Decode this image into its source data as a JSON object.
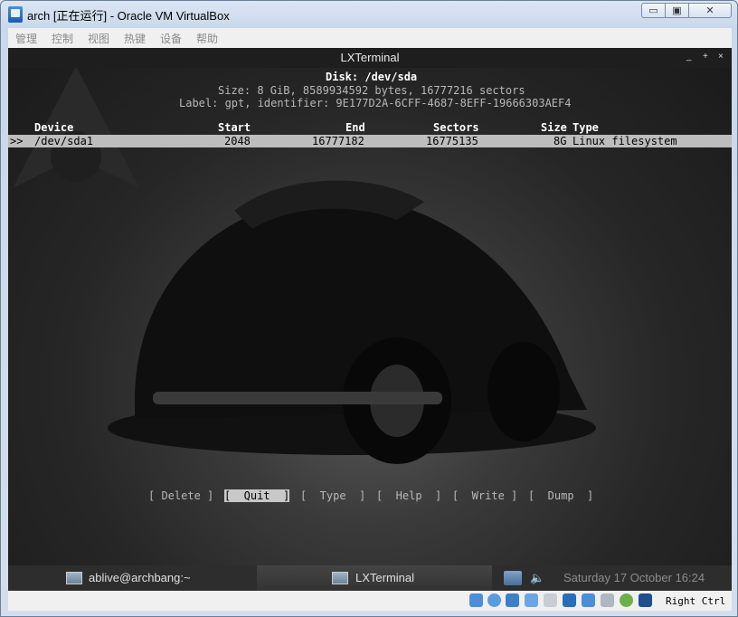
{
  "window": {
    "title": "arch [正在运行] - Oracle VM VirtualBox",
    "controls": {
      "minimize": "▭",
      "maximize": "▣",
      "close": "✕"
    }
  },
  "menu": [
    "管理",
    "控制",
    "视图",
    "热键",
    "设备",
    "帮助"
  ],
  "terminal": {
    "title": "LXTerminal",
    "controls": [
      "_",
      "+",
      "×"
    ]
  },
  "cfdisk": {
    "disk_line": "Disk: /dev/sda",
    "size_line": "Size: 8 GiB, 8589934592 bytes, 16777216 sectors",
    "label_line": "Label: gpt, identifier: 9E177D2A-6CFF-4687-8EFF-19666303AEF4",
    "columns": {
      "device": "Device",
      "start": "Start",
      "end": "End",
      "sectors": "Sectors",
      "size": "Size",
      "type": "Type"
    },
    "row": {
      "marker": ">>",
      "device": "/dev/sda1",
      "start": "2048",
      "end": "16777182",
      "sectors": "16775135",
      "size": "8G",
      "type": "Linux filesystem"
    },
    "actions": [
      "[ Delete ]",
      "[  Quit  ]",
      "[  Type  ]",
      "[  Help  ]",
      "[  Write ]",
      "[  Dump  ]"
    ]
  },
  "taskbar": {
    "task1": "ablive@archbang:~",
    "task2": "LXTerminal",
    "clock": "Saturday 17 October 16:24"
  },
  "statusbar": {
    "host_key": "Right Ctrl",
    "icons": [
      "hard-disk-icon",
      "optical-drive-icon",
      "usb-icon",
      "pen-icon",
      "shared-folder-icon",
      "display-icon",
      "network-icon",
      "capture-icon",
      "mouse-integration-icon",
      "download-icon"
    ]
  }
}
